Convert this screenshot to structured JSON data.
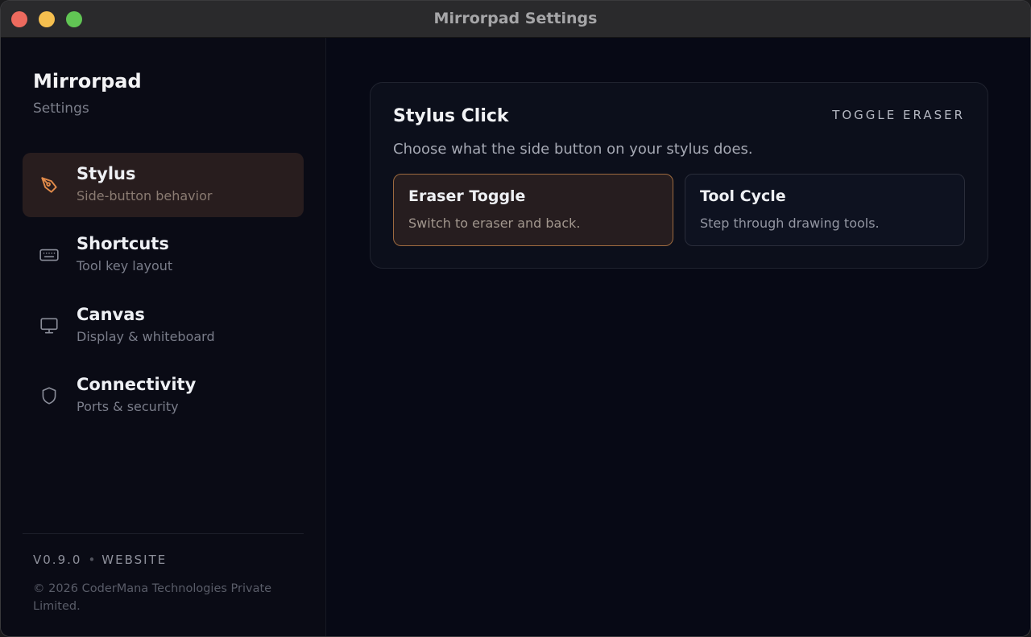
{
  "window": {
    "title": "Mirrorpad Settings"
  },
  "sidebar": {
    "brand": "Mirrorpad",
    "subtitle": "Settings",
    "items": [
      {
        "label": "Stylus",
        "desc": "Side-button behavior",
        "icon": "pen-nib-icon",
        "active": true
      },
      {
        "label": "Shortcuts",
        "desc": "Tool key layout",
        "icon": "keyboard-icon",
        "active": false
      },
      {
        "label": "Canvas",
        "desc": "Display & whiteboard",
        "icon": "monitor-icon",
        "active": false
      },
      {
        "label": "Connectivity",
        "desc": "Ports & security",
        "icon": "shield-icon",
        "active": false
      }
    ],
    "footer": {
      "version": "V0.9.0",
      "separator": "•",
      "website": "WEBSITE",
      "copyright": "© 2026 CoderMana Technologies Private Limited."
    }
  },
  "main": {
    "card": {
      "title": "Stylus Click",
      "badge": "TOGGLE ERASER",
      "description": "Choose what the side button on your stylus does.",
      "options": [
        {
          "title": "Eraser Toggle",
          "desc": "Switch to eraser and back.",
          "selected": true
        },
        {
          "title": "Tool Cycle",
          "desc": "Step through drawing tools.",
          "selected": false
        }
      ]
    }
  },
  "colors": {
    "accent": "#e08a4a",
    "selected_border": "#9d6a3f",
    "background": "#070915"
  }
}
